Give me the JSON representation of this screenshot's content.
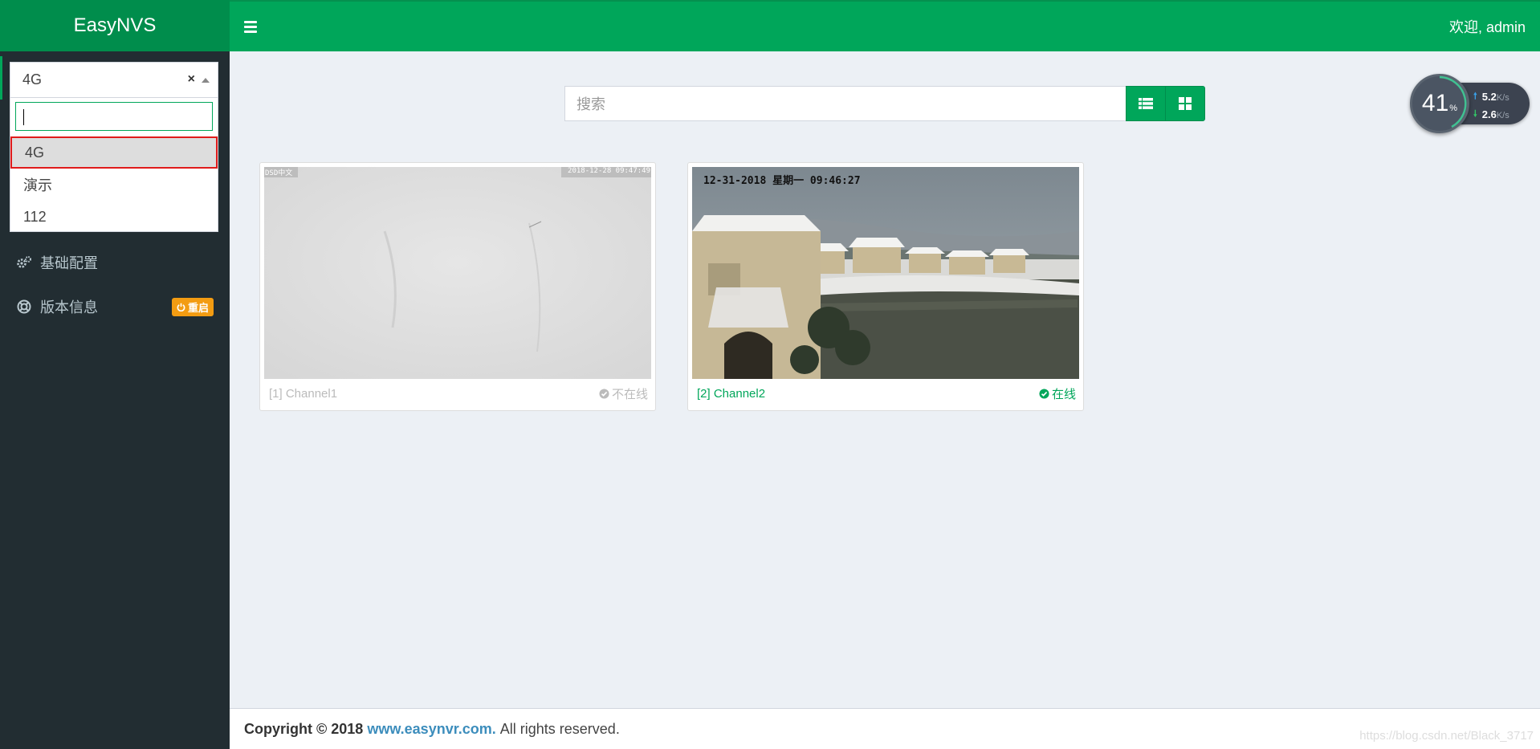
{
  "header": {
    "logo": "EasyNVS",
    "welcome": "欢迎, admin"
  },
  "sidebar": {
    "select": {
      "value": "4G",
      "clear": "×",
      "options": [
        "4G",
        "演示",
        "112"
      ],
      "selected_index": 0
    },
    "items": [
      {
        "label": "基础配置",
        "icon": "cogs-icon"
      },
      {
        "label": "版本信息",
        "icon": "life-ring-icon",
        "badge": "重启"
      }
    ]
  },
  "toolbar": {
    "search_placeholder": "搜索",
    "list_view_icon": "list-icon",
    "grid_view_icon": "grid-icon"
  },
  "speed_widget": {
    "percent": "41",
    "percent_sign": "%",
    "upload": "5.2",
    "download": "2.6",
    "unit": "K/s"
  },
  "channels": [
    {
      "label": "[1] Channel1",
      "status": "不在线",
      "online": false,
      "osd_left": "DSD中文",
      "osd_right": "2018-12-28 09:47:49"
    },
    {
      "label": "[2] Channel2",
      "status": "在线",
      "online": true,
      "osd": "12-31-2018 星期一 09:46:27"
    }
  ],
  "footer": {
    "copyright": "Copyright © 2018",
    "link": "www.easynvr.com.",
    "rights": "All rights reserved.",
    "watermark": "https://blog.csdn.net/Black_3717"
  },
  "colors": {
    "brand_green": "#00a65a",
    "logo_green": "#008d4c",
    "sidebar_bg": "#222d32",
    "badge_orange": "#f39c12",
    "selection_border": "#e01b1b"
  }
}
